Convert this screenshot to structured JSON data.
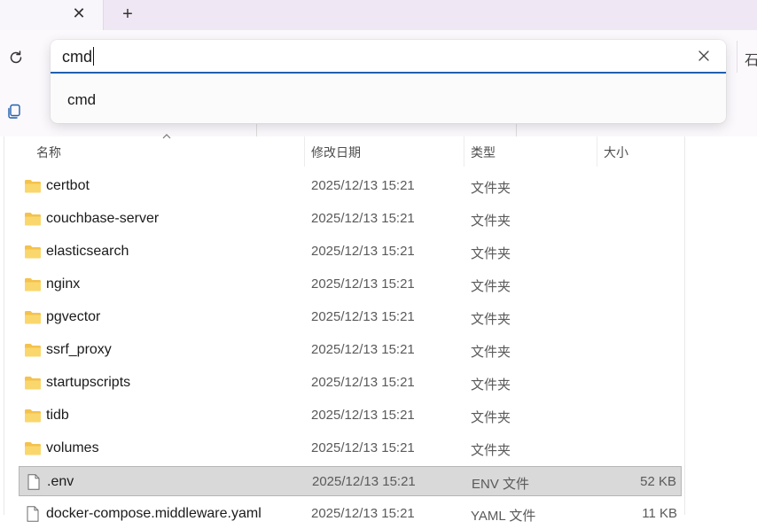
{
  "tab": {
    "close_icon": "close-icon",
    "new_tab_icon": "plus-icon"
  },
  "nav": {
    "right_edge_text": "石"
  },
  "search": {
    "value": "cmd",
    "suggestions": [
      "cmd"
    ]
  },
  "columns": {
    "name": "名称",
    "modified": "修改日期",
    "type": "类型",
    "size": "大小"
  },
  "files": [
    {
      "name": "certbot",
      "modified": "2025/12/13 15:21",
      "type": "文件夹",
      "size": "",
      "icon": "folder-icon"
    },
    {
      "name": "couchbase-server",
      "modified": "2025/12/13 15:21",
      "type": "文件夹",
      "size": "",
      "icon": "folder-icon"
    },
    {
      "name": "elasticsearch",
      "modified": "2025/12/13 15:21",
      "type": "文件夹",
      "size": "",
      "icon": "folder-icon"
    },
    {
      "name": "nginx",
      "modified": "2025/12/13 15:21",
      "type": "文件夹",
      "size": "",
      "icon": "folder-icon"
    },
    {
      "name": "pgvector",
      "modified": "2025/12/13 15:21",
      "type": "文件夹",
      "size": "",
      "icon": "folder-icon"
    },
    {
      "name": "ssrf_proxy",
      "modified": "2025/12/13 15:21",
      "type": "文件夹",
      "size": "",
      "icon": "folder-icon"
    },
    {
      "name": "startupscripts",
      "modified": "2025/12/13 15:21",
      "type": "文件夹",
      "size": "",
      "icon": "folder-icon"
    },
    {
      "name": "tidb",
      "modified": "2025/12/13 15:21",
      "type": "文件夹",
      "size": "",
      "icon": "folder-icon"
    },
    {
      "name": "volumes",
      "modified": "2025/12/13 15:21",
      "type": "文件夹",
      "size": "",
      "icon": "folder-icon"
    },
    {
      "name": ".env",
      "modified": "2025/12/13 15:21",
      "type": "ENV 文件",
      "size": "52 KB",
      "icon": "file-icon",
      "selected": true
    },
    {
      "name": "docker-compose.middleware.yaml",
      "modified": "2025/12/13 15:21",
      "type": "YAML 文件",
      "size": "11 KB",
      "icon": "file-icon"
    }
  ],
  "colors": {
    "accent": "#1f5fad",
    "folder": "#f4c24d",
    "selection": "#d9d9d9"
  }
}
